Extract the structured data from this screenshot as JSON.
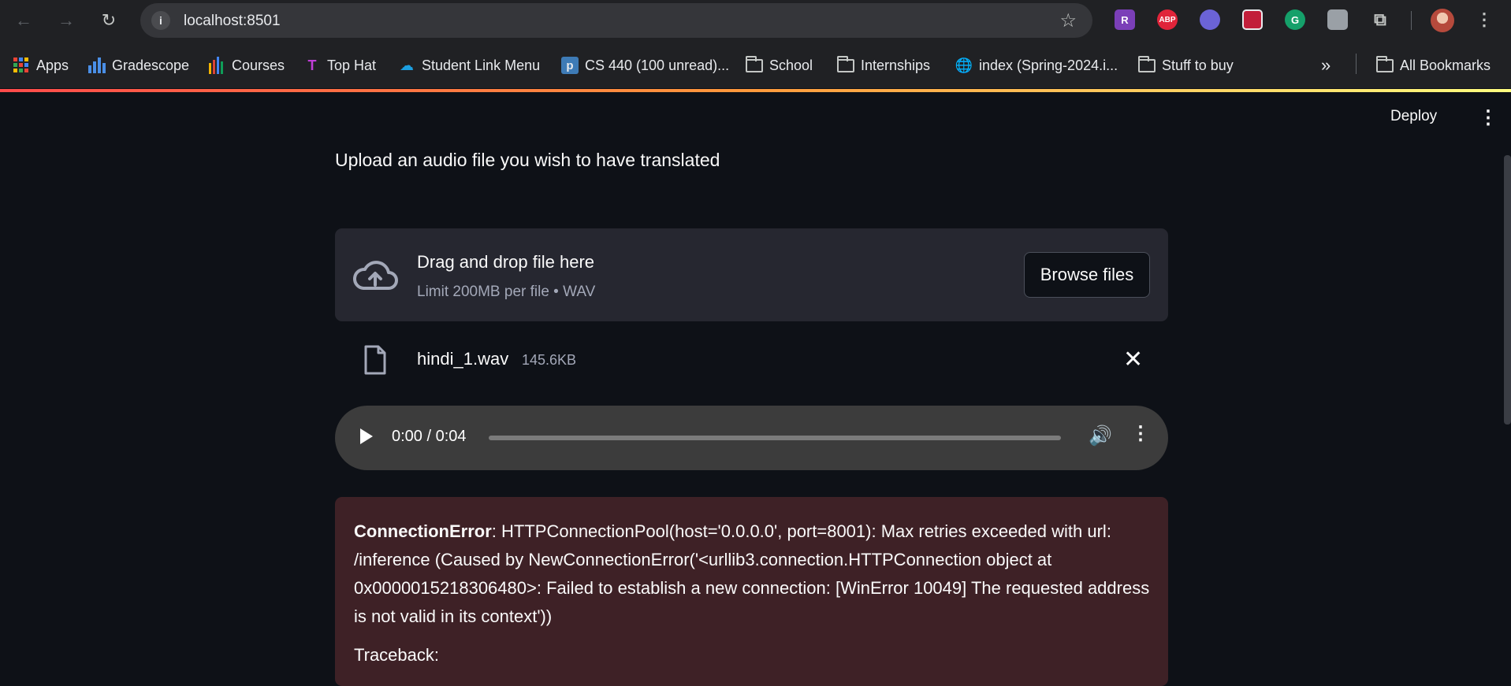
{
  "browser": {
    "url": "localhost:8501",
    "extensions": [
      {
        "name": "R",
        "color": "#7b3fb8"
      },
      {
        "name": "ABP",
        "color": "#e0243a"
      },
      {
        "name": "",
        "color": "#6b63d6"
      },
      {
        "name": "",
        "color": "#c21e3a"
      },
      {
        "name": "G",
        "color": "#15a06a"
      },
      {
        "name": "",
        "color": "#9aa0a6"
      }
    ]
  },
  "bookmarks": [
    {
      "label": "Apps",
      "icon": "apps-grid-icon"
    },
    {
      "label": "Gradescope",
      "icon": "gradescope-icon"
    },
    {
      "label": "Courses",
      "icon": "courses-icon"
    },
    {
      "label": "Top Hat",
      "icon": "tophat-icon"
    },
    {
      "label": "Student Link Menu",
      "icon": "salesforce-cloud-icon"
    },
    {
      "label": "CS 440 (100 unread)...",
      "icon": "piazza-icon"
    },
    {
      "label": "School",
      "icon": "folder-icon"
    },
    {
      "label": "Internships",
      "icon": "folder-icon"
    },
    {
      "label": "index (Spring-2024.i...",
      "icon": "globe-icon"
    },
    {
      "label": "Stuff to buy",
      "icon": "folder-icon"
    },
    {
      "label": "All Bookmarks",
      "icon": "folder-icon"
    }
  ],
  "app": {
    "deploy_label": "Deploy",
    "title": "Upload an audio file you wish to have translated",
    "uploader": {
      "drop_text": "Drag and drop file here",
      "limit_text": "Limit 200MB per file • WAV",
      "browse_label": "Browse files"
    },
    "file": {
      "name": "hindi_1.wav",
      "size": "145.6KB"
    },
    "audio": {
      "time": "0:00 / 0:04",
      "progress": 0
    },
    "error": {
      "type": "ConnectionError",
      "message": ": HTTPConnectionPool(host='0.0.0.0', port=8001): Max retries exceeded with url: /inference (Caused by NewConnectionError('<urllib3.connection.HTTPConnection object at 0x0000015218306480>: Failed to establish a new connection: [WinError 10049] The requested address is not valid in its context'))",
      "traceback_label": "Traceback:"
    }
  }
}
